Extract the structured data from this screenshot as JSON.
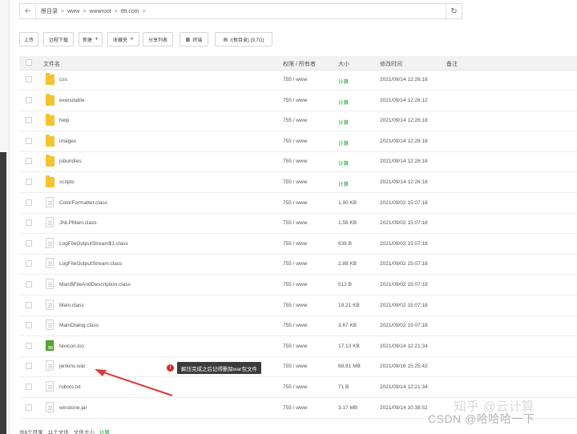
{
  "address_bar": {
    "crumbs": [
      "根目录",
      "www",
      "wwwroot",
      "tttt.com"
    ],
    "separator": ">"
  },
  "toolbar": {
    "upload": "上传",
    "remote_download": "远程下载",
    "new": "新建",
    "favorites": "收藏夹",
    "share_list": "分享列表",
    "terminal": "终端",
    "disk": "/(根目录) (9.7G)"
  },
  "table": {
    "headers": {
      "name": "文件名",
      "perm": "权限 / 所有者",
      "size": "大小",
      "mtime": "修改时间",
      "note": "备注"
    },
    "rows": [
      {
        "type": "folder",
        "name": "css",
        "perm": "755 / www",
        "size": "计算",
        "mtime": "2021/09/14 12:26:18"
      },
      {
        "type": "folder",
        "name": "executable",
        "perm": "755 / www",
        "size": "计算",
        "mtime": "2021/09/14 12:26:12"
      },
      {
        "type": "folder",
        "name": "help",
        "perm": "755 / www",
        "size": "计算",
        "mtime": "2021/09/14 12:26:18"
      },
      {
        "type": "folder",
        "name": "images",
        "perm": "755 / www",
        "size": "计算",
        "mtime": "2021/09/14 12:26:18"
      },
      {
        "type": "folder",
        "name": "jsbundles",
        "perm": "755 / www",
        "size": "计算",
        "mtime": "2021/09/14 12:26:18"
      },
      {
        "type": "folder",
        "name": "scripts",
        "perm": "755 / www",
        "size": "计算",
        "mtime": "2021/09/14 12:26:18"
      },
      {
        "type": "file",
        "name": "ColorFormatter.class",
        "perm": "755 / www",
        "size": "1.90 KB",
        "mtime": "2021/09/02 15:07:18"
      },
      {
        "type": "file",
        "name": "JNLPMain.class",
        "perm": "755 / www",
        "size": "1.58 KB",
        "mtime": "2021/09/02 15:07:18"
      },
      {
        "type": "file",
        "name": "LogFileOutputStream$1.class",
        "perm": "755 / www",
        "size": "636 B",
        "mtime": "2021/09/02 15:07:18"
      },
      {
        "type": "file",
        "name": "LogFileOutputStream.class",
        "perm": "755 / www",
        "size": "2.88 KB",
        "mtime": "2021/09/02 15:07:18"
      },
      {
        "type": "file",
        "name": "Main$FileAndDescription.class",
        "perm": "755 / www",
        "size": "512 B",
        "mtime": "2021/09/02 15:07:18"
      },
      {
        "type": "file",
        "name": "Main.class",
        "perm": "755 / www",
        "size": "19.21 KB",
        "mtime": "2021/09/02 15:07:18"
      },
      {
        "type": "file",
        "name": "MainDialog.class",
        "perm": "755 / www",
        "size": "3.67 KB",
        "mtime": "2021/09/02 15:07:18"
      },
      {
        "type": "image",
        "name": "favicon.ico",
        "perm": "755 / www",
        "size": "17.13 KB",
        "mtime": "2021/09/14 12:21:34"
      },
      {
        "type": "file",
        "name": "jenkins.war",
        "perm": "755 / www",
        "size": "68.81 MB",
        "mtime": "2021/09/16 15:25:42"
      },
      {
        "type": "file",
        "name": "robots.txt",
        "perm": "755 / www",
        "size": "71 B",
        "mtime": "2021/09/14 12:21:34"
      },
      {
        "type": "file",
        "name": "winstone.jar",
        "perm": "755 / www",
        "size": "3.17 MB",
        "mtime": "2021/09/14 10:38:52"
      }
    ]
  },
  "tooltip": {
    "badge": "!",
    "text": "解压完成之后记得删除war包文件"
  },
  "footer": {
    "dirs": "共6个目录",
    "files": "11个文件",
    "dir_size_label": "文件大小",
    "dir_size_value": "计算"
  },
  "watermark": {
    "zhihu": "知乎 @云计算",
    "csdn": "CSDN @哈哈哈一下"
  },
  "colors": {
    "folder": "#f5c32e",
    "green": "#20a53a",
    "tooltip_bg": "#3b3b3b",
    "badge": "#e02828",
    "arrow": "#d93a3a"
  }
}
